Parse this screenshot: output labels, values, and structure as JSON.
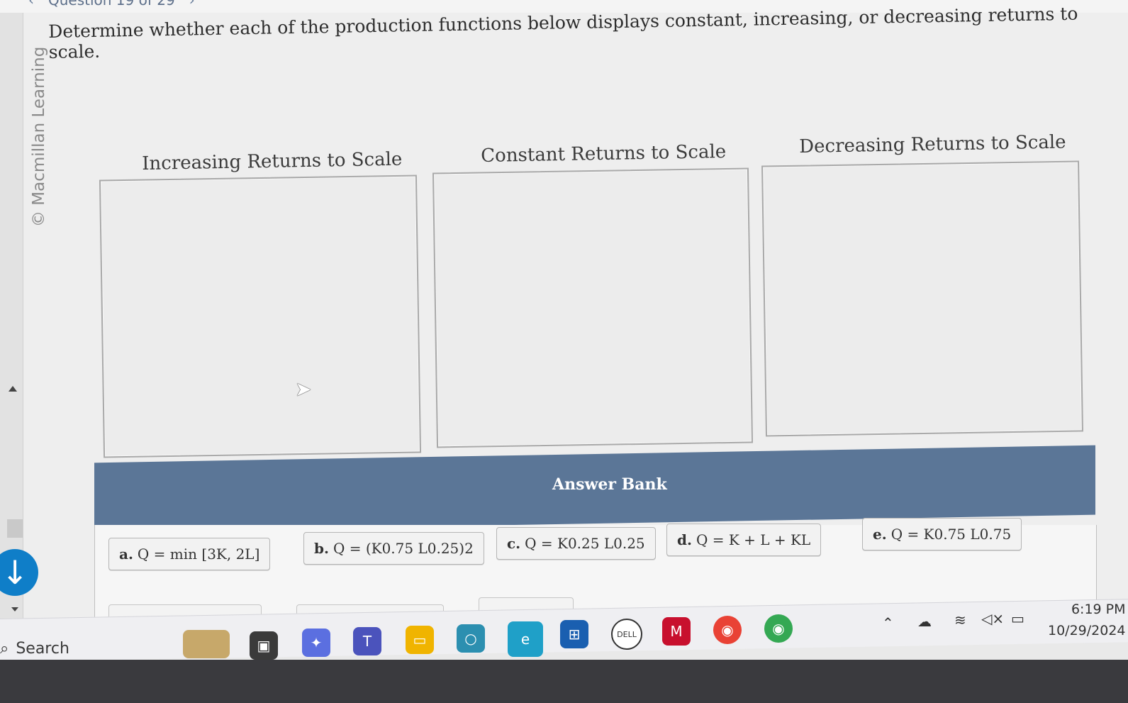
{
  "header": {
    "question_label": "Question 19 of 29",
    "prev_icon": "chevron-left-icon",
    "next_icon": "chevron-right-icon"
  },
  "watermark": "© Macmillan Learning",
  "instructions": "Determine whether each of the production functions below displays constant, increasing, or decreasing returns to scale.",
  "zones": [
    {
      "label": "Increasing Returns to Scale"
    },
    {
      "label": "Constant Returns to Scale"
    },
    {
      "label": "Decreasing Returns to Scale"
    }
  ],
  "answer_bank": {
    "title": "Answer Bank",
    "items": [
      {
        "letter": "a.",
        "formula": "Q = min [3K, 2L]"
      },
      {
        "letter": "b.",
        "formula": "Q = (K0.75 L0.25)2"
      },
      {
        "letter": "c.",
        "formula": "Q = K0.25 L0.25"
      },
      {
        "letter": "d.",
        "formula": "Q = K + L + KL"
      },
      {
        "letter": "e.",
        "formula": "Q = K0.75 L0.75"
      }
    ]
  },
  "taskbar": {
    "search_label": "Search",
    "time": "6:19 PM",
    "date": "10/29/2024"
  },
  "colors": {
    "bank_header": "#5b7697",
    "download_button": "#0f7ec8"
  }
}
